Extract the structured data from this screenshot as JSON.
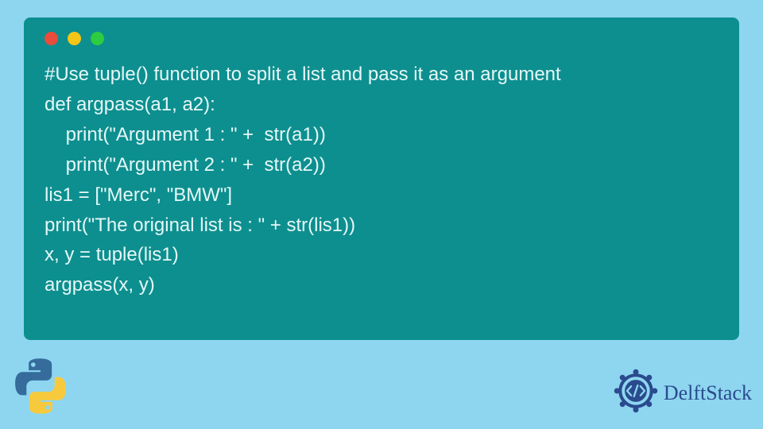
{
  "code": {
    "line1": "#Use tuple() function to split a list and pass it as an argument",
    "line2": "def argpass(a1, a2):",
    "line3": "    print(\"Argument 1 : \" +  str(a1))",
    "line4": "    print(\"Argument 2 : \" +  str(a2))",
    "line5": "lis1 = [\"Merc\", \"BMW\"]",
    "line6": "print(\"The original list is : \" + str(lis1))",
    "line7": "x, y = tuple(lis1)",
    "line8": "argpass(x, y)"
  },
  "brand": {
    "name": "DelftStack"
  },
  "colors": {
    "bg": "#8ed6f0",
    "card": "#0d8f8f",
    "text": "#e6f7f7",
    "brand": "#2a4b8d"
  }
}
